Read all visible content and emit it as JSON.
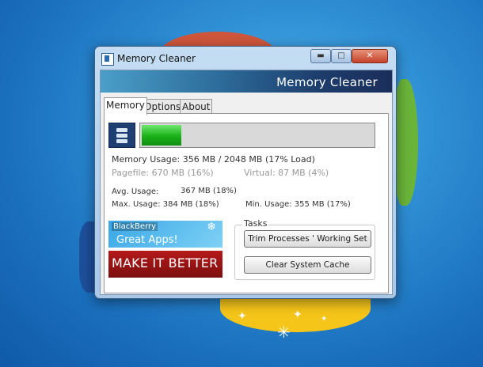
{
  "window": {
    "title": "Memory Cleaner"
  },
  "banner": {
    "text": "Memory Cleaner"
  },
  "tabs": [
    {
      "label": "Memory",
      "active": true
    },
    {
      "label": "Options",
      "active": false
    },
    {
      "label": "About",
      "active": false
    }
  ],
  "memory": {
    "load_fraction": 0.17,
    "usage": "Memory Usage: 356 MB / 2048 MB (17% Load)",
    "pagefile": "Pagefile: 670 MB (16%)",
    "virtual": "Virtual: 87 MB (4%)",
    "avg_label": "Avg. Usage:",
    "avg_value": "367 MB (18%)",
    "max": "Max. Usage: 384 MB (18%)",
    "min": "Min. Usage: 355 MB (17%)"
  },
  "ads": {
    "blackberry_brand": "BlackBerry",
    "blackberry_slogan": "Great Apps!",
    "make_it_better": "MAKE IT BETTER"
  },
  "tasks": {
    "title": "Tasks",
    "trim_button": "Trim Processes ' Working Set",
    "clear_button": "Clear System Cache"
  },
  "colors": {
    "progress_fill": "#19b019",
    "banner_dark": "#1b2d5a"
  }
}
